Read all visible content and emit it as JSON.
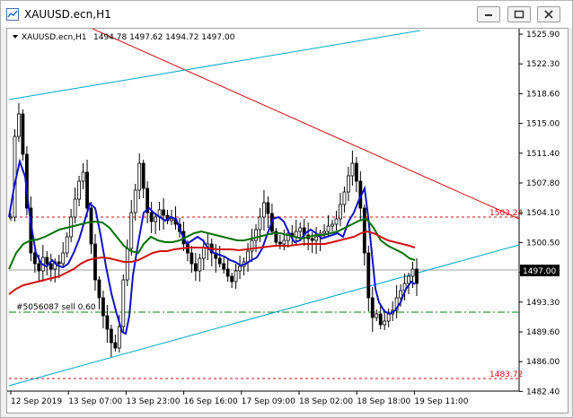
{
  "window": {
    "title": "XAUUSD.ecn,H1"
  },
  "chart_header": {
    "symbol_info": "XAUUSD.ecn,H1",
    "ohlc": "1494.78 1497.62 1494.72 1497.00"
  },
  "order_label": "#5056087 sell 0.60",
  "price_labels": {
    "upper_level": "1503.24",
    "lower_level": "1483.72",
    "current_price": "1497.00"
  },
  "colors": {
    "candles": "#000000",
    "blue_ma": "#1010c8",
    "green_ma": "#007000",
    "red_ma": "#d01010",
    "trendline_red": "#d01010",
    "channel_cyan": "#00a8c8",
    "level_red": "#d01010",
    "order_green": "#008000",
    "current_price_line": "#a0a0a0"
  },
  "chart_data": {
    "type": "candlestick",
    "title": "XAUUSD.ecn,H1",
    "y_ticks": [
      "1525.90",
      "1522.30",
      "1518.60",
      "1515.00",
      "1511.40",
      "1507.80",
      "1504.10",
      "1500.50",
      "1497.00",
      "1493.30",
      "1489.60",
      "1486.00",
      "1482.40"
    ],
    "x_ticks": [
      "12 Sep 2019",
      "13 Sep 07:00",
      "13 Sep 23:00",
      "16 Sep 16:00",
      "17 Sep 09:00",
      "18 Sep 02:00",
      "18 Sep 18:00",
      "19 Sep 11:00"
    ],
    "ylim": [
      1482.4,
      1526.6
    ],
    "levels": {
      "upper": 1503.24,
      "lower": 1483.72,
      "order": 1492.2,
      "current": 1497.0
    },
    "grid": false
  }
}
